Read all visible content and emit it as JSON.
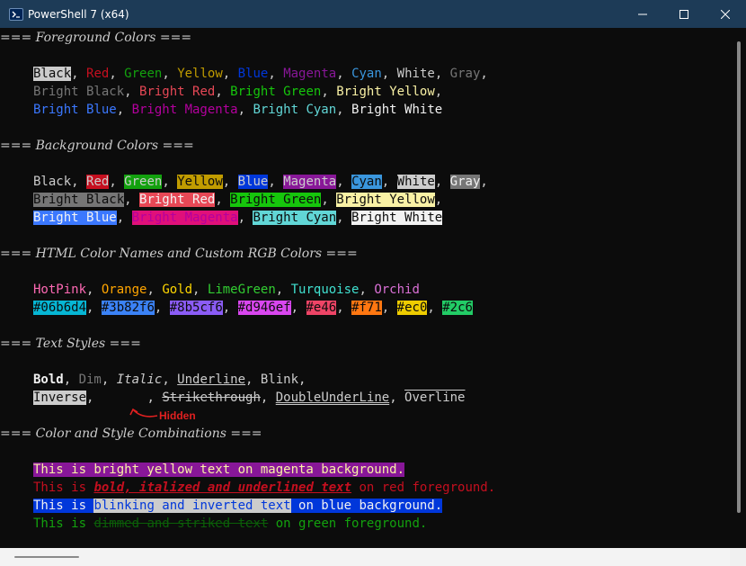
{
  "window": {
    "title": "PowerShell 7 (x64)",
    "icon": "powershell-icon",
    "controls": [
      "minimize-icon",
      "maximize-icon",
      "close-icon"
    ]
  },
  "headers": {
    "fg": "=== Foreground Colors ===",
    "bg": "=== Background Colors ===",
    "html": "=== HTML Color Names and Custom RGB Colors ===",
    "styles": "=== Text Styles ===",
    "combos": "=== Color and Style Combinations ==="
  },
  "fg_colors": {
    "black": "Black",
    "red": "Red",
    "green": "Green",
    "yellow": "Yellow",
    "blue": "Blue",
    "magenta": "Magenta",
    "cyan": "Cyan",
    "white": "White",
    "gray": "Gray",
    "bright_black": "Bright Black",
    "bright_red": "Bright Red",
    "bright_green": "Bright Green",
    "bright_yellow": "Bright Yellow",
    "bright_blue": "Bright Blue",
    "bright_magenta": "Bright Magenta",
    "bright_cyan": "Bright Cyan",
    "bright_white": "Bright White"
  },
  "bg_colors": {
    "black": "Black",
    "red": "Red",
    "green": "Green",
    "yellow": "Yellow",
    "blue": "Blue",
    "magenta": "Magenta",
    "cyan": "Cyan",
    "white": "White",
    "gray": "Gray",
    "bright_black": "Bright Black",
    "bright_red": "Bright Red",
    "bright_green": "Bright Green",
    "bright_yellow": "Bright Yellow",
    "bright_blue": "Bright Blue",
    "bright_magenta": "Bright Magenta",
    "bright_cyan": "Bright Cyan",
    "bright_white": "Bright White"
  },
  "html_names": {
    "hotpink": "HotPink",
    "orange": "Orange",
    "gold": "Gold",
    "limegreen": "LimeGreen",
    "turquoise": "Turquoise",
    "orchid": "Orchid"
  },
  "rgb_codes": {
    "c1": "#06b6d4",
    "c2": "#3b82f6",
    "c3": "#8b5cf6",
    "c4": "#d946ef",
    "c5": "#e46",
    "c6": "#f71",
    "c7": "#ec0",
    "c8": "#2c6"
  },
  "styles": {
    "bold": "Bold",
    "dim": "Dim",
    "italic": "Italic",
    "underline": "Underline",
    "blink": "Blink",
    "inverse": "Inverse",
    "strikethrough": "Strikethrough",
    "double_underline": "DoubleUnderLine",
    "overline": "Overline",
    "hidden_note": "Hidden"
  },
  "combos": {
    "l1": "This is bright yellow text on magenta background.",
    "l2_a": "This is ",
    "l2_b": "bold, italized and underlined text",
    "l2_c": " on red foreground.",
    "l3_a": "This is ",
    "l3_b": "blinking and inverted text",
    "l3_c": " on blue background.",
    "l4_a": "This is ",
    "l4_b": "dimmed and striked text",
    "l4_c": " on green foreground."
  },
  "separator": ", ",
  "palette": {
    "background": "#0c0c0c",
    "foreground": "#cccccc",
    "black": "#0c0c0c",
    "red": "#c50f1f",
    "green": "#13a10e",
    "yellow": "#c19c00",
    "blue": "#0037da",
    "magenta": "#881798",
    "cyan": "#3a96dd",
    "white": "#cccccc",
    "bright_black": "#767676",
    "bright_red": "#e74856",
    "bright_green": "#16c60c",
    "bright_yellow": "#f9f1a5",
    "bright_blue": "#3b78ff",
    "bright_magenta": "#b4009e",
    "bright_cyan": "#61d6d6",
    "bright_white": "#f2f2f2",
    "titlebar": "#1d3b57",
    "annotation": "#e02020"
  }
}
